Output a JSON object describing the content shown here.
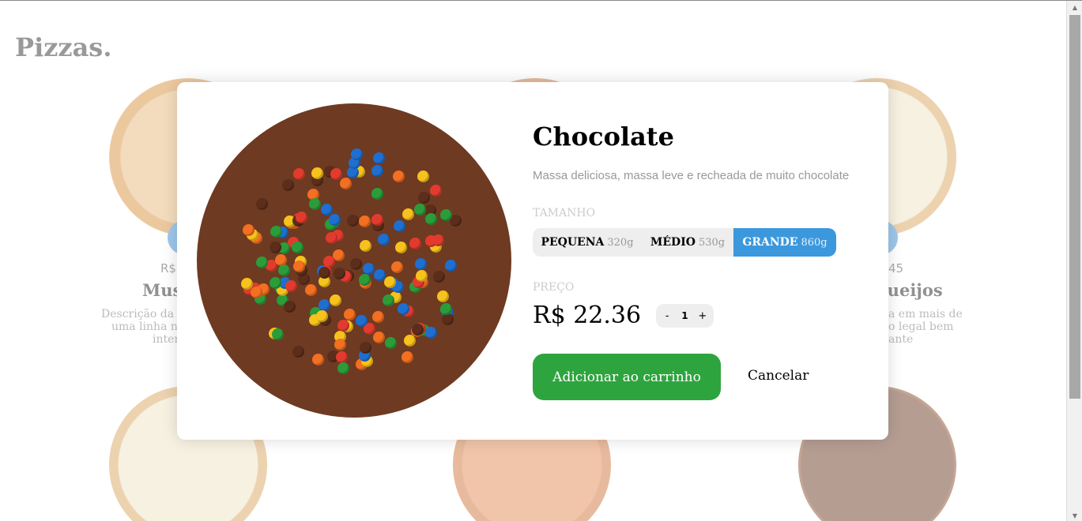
{
  "page": {
    "title": "Pizzas."
  },
  "background_cards": [
    {
      "price": "R$",
      "name": "Mus",
      "desc": [
        "Descrição da",
        "uma linha n",
        "inter"
      ]
    },
    {
      "price": "45",
      "name": "queijos",
      "desc": [
        "a em mais de",
        "o legal bem",
        "ante"
      ]
    }
  ],
  "modal": {
    "title": "Chocolate",
    "description": "Massa deliciosa, massa leve e recheada de muito chocolate",
    "size_label": "TAMANHO",
    "sizes": [
      {
        "name": "PEQUENA",
        "weight": "320g",
        "selected": false
      },
      {
        "name": "MÉDIO",
        "weight": "530g",
        "selected": false
      },
      {
        "name": "GRANDE",
        "weight": "860g",
        "selected": true
      }
    ],
    "price_label": "PREÇO",
    "price": "R$ 22.36",
    "quantity": {
      "minus": "-",
      "value": "1",
      "plus": "+"
    },
    "add_button": "Adicionar ao carrinho",
    "cancel_button": "Cancelar"
  },
  "colors": {
    "accent_blue": "#3b98dd",
    "add_green": "#2ea43e",
    "overlay": "rgba(255,255,255,0.5)"
  },
  "icons": {
    "scroll_up": "scroll-up-arrow-icon",
    "scroll_down": "scroll-down-arrow-icon"
  }
}
